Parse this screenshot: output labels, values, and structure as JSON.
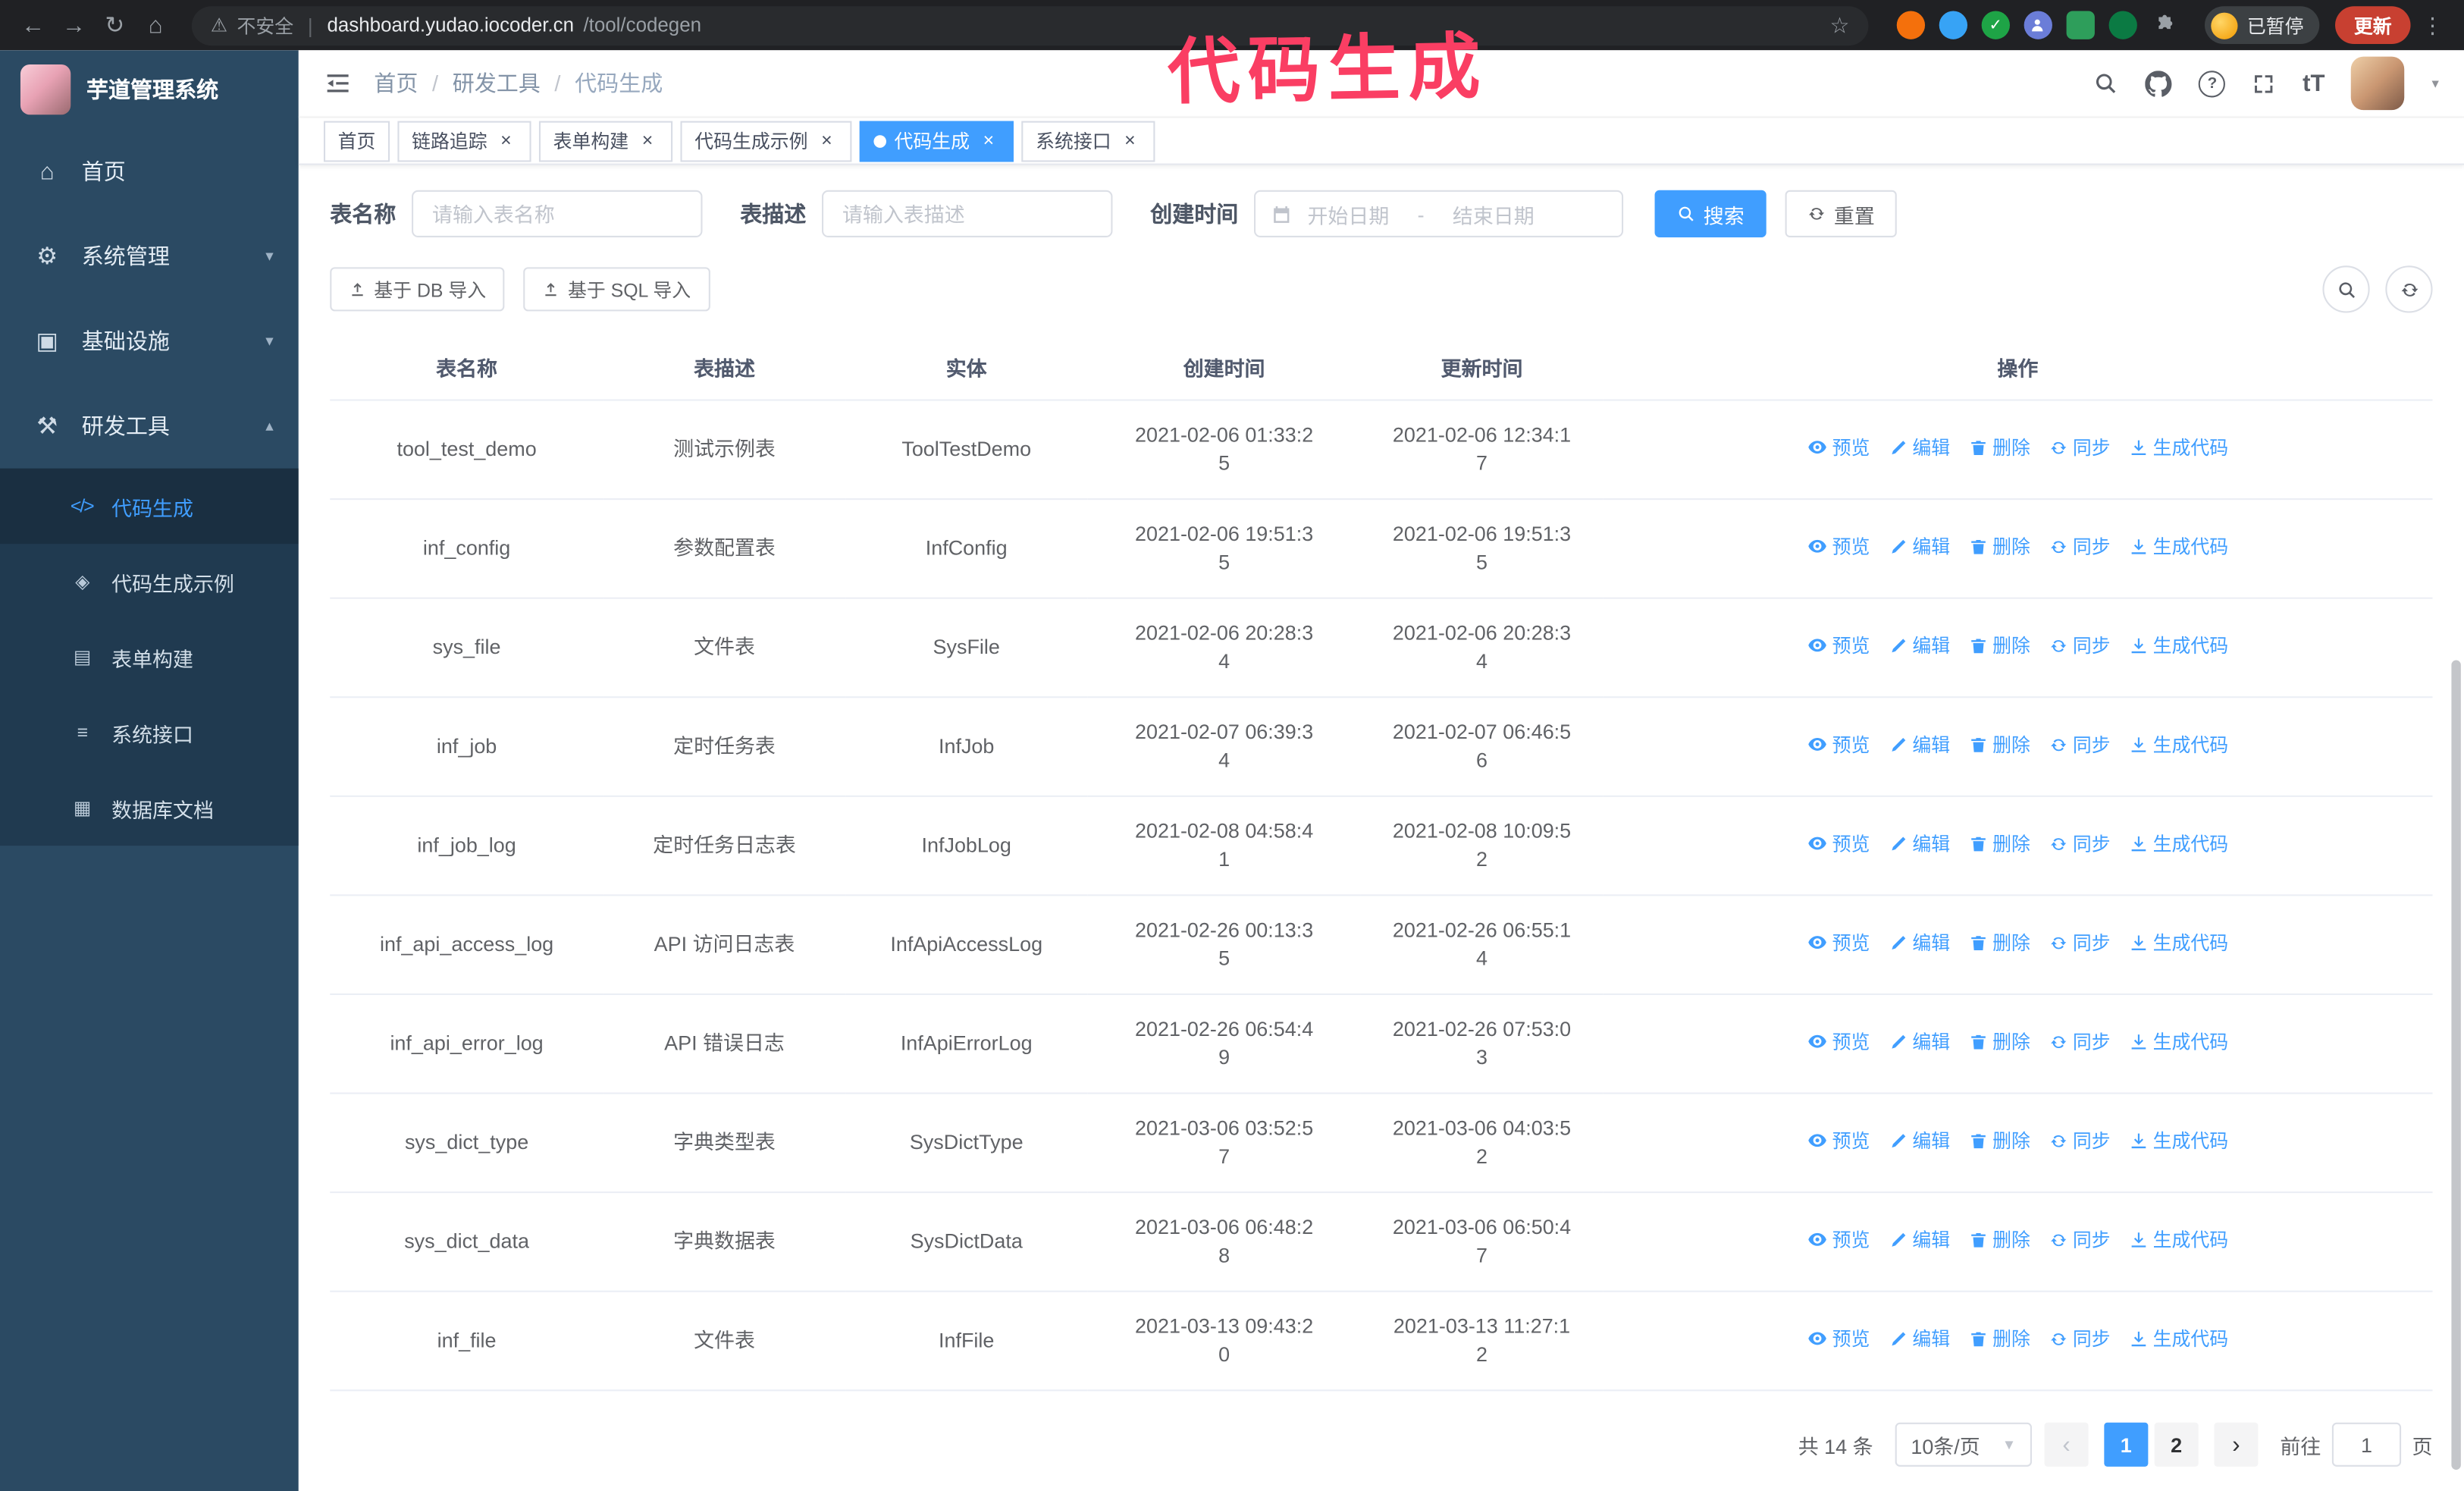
{
  "colors": {
    "accent": "#409eff",
    "annotation": "#fa3e63",
    "sidebar_bg": "#2b4a63",
    "chrome_bg": "#202124"
  },
  "annotation": {
    "text": "代码生成"
  },
  "browser": {
    "security_label": "不安全",
    "url_host": "dashboard.yudao.iocoder.cn",
    "url_path": "/tool/codegen",
    "paused_badge": "已暂停",
    "update_button": "更新"
  },
  "sidebar": {
    "logo_title": "芋道管理系统",
    "items": [
      {
        "key": "home",
        "label": "首页",
        "icon": "⌂",
        "icon_name": "home-icon"
      },
      {
        "key": "system-management",
        "label": "系统管理",
        "icon": "⚙",
        "icon_name": "gear-icon",
        "chevron": "down"
      },
      {
        "key": "infrastructure",
        "label": "基础设施",
        "icon": "▣",
        "icon_name": "monitor-icon",
        "chevron": "down"
      },
      {
        "key": "dev-tools",
        "label": "研发工具",
        "icon": "⚒",
        "icon_name": "tools-icon",
        "chevron": "up",
        "expanded": true
      }
    ],
    "subitems": [
      {
        "key": "codegen",
        "label": "代码生成",
        "icon": "</>",
        "icon_name": "code-icon",
        "active": true
      },
      {
        "key": "codegen-example",
        "label": "代码生成示例",
        "icon": "◈",
        "icon_name": "example-icon"
      },
      {
        "key": "form-builder",
        "label": "表单构建",
        "icon": "▤",
        "icon_name": "form-icon"
      },
      {
        "key": "system-api",
        "label": "系统接口",
        "icon": "≡",
        "icon_name": "api-icon"
      },
      {
        "key": "db-doc",
        "label": "数据库文档",
        "icon": "▦",
        "icon_name": "database-doc-icon"
      }
    ]
  },
  "header": {
    "breadcrumb": [
      "首页",
      "研发工具",
      "代码生成"
    ],
    "font_size_icon": "tT"
  },
  "tabs": [
    {
      "key": "home",
      "label": "首页",
      "closable": false
    },
    {
      "key": "tracer",
      "label": "链路追踪",
      "closable": true
    },
    {
      "key": "form-builder",
      "label": "表单构建",
      "closable": true
    },
    {
      "key": "codegen-example",
      "label": "代码生成示例",
      "closable": true
    },
    {
      "key": "codegen",
      "label": "代码生成",
      "closable": true,
      "active": true
    },
    {
      "key": "system-api",
      "label": "系统接口",
      "closable": true
    }
  ],
  "filters": {
    "table_name_label": "表名称",
    "table_name_placeholder": "请输入表名称",
    "table_desc_label": "表描述",
    "table_desc_placeholder": "请输入表描述",
    "create_time_label": "创建时间",
    "start_placeholder": "开始日期",
    "range_separator": "-",
    "end_placeholder": "结束日期",
    "search_button": "搜索",
    "reset_button": "重置"
  },
  "toolbar": {
    "import_db_button": "基于 DB 导入",
    "import_sql_button": "基于 SQL 导入"
  },
  "table": {
    "columns": [
      "表名称",
      "表描述",
      "实体",
      "创建时间",
      "更新时间",
      "操作"
    ],
    "ops": [
      {
        "key": "preview",
        "label": "预览",
        "icon_name": "eye-icon"
      },
      {
        "key": "edit",
        "label": "编辑",
        "icon_name": "edit-icon"
      },
      {
        "key": "delete",
        "label": "删除",
        "icon_name": "trash-icon"
      },
      {
        "key": "sync",
        "label": "同步",
        "icon_name": "sync-icon"
      },
      {
        "key": "generate",
        "label": "生成代码",
        "icon_name": "download-icon"
      }
    ],
    "rows": [
      {
        "name": "tool_test_demo",
        "desc": "测试示例表",
        "entity": "ToolTestDemo",
        "created": "2021-02-06 01:33:25",
        "updated": "2021-02-06 12:34:17"
      },
      {
        "name": "inf_config",
        "desc": "参数配置表",
        "entity": "InfConfig",
        "created": "2021-02-06 19:51:35",
        "updated": "2021-02-06 19:51:35"
      },
      {
        "name": "sys_file",
        "desc": "文件表",
        "entity": "SysFile",
        "created": "2021-02-06 20:28:34",
        "updated": "2021-02-06 20:28:34"
      },
      {
        "name": "inf_job",
        "desc": "定时任务表",
        "entity": "InfJob",
        "created": "2021-02-07 06:39:34",
        "updated": "2021-02-07 06:46:56"
      },
      {
        "name": "inf_job_log",
        "desc": "定时任务日志表",
        "entity": "InfJobLog",
        "created": "2021-02-08 04:58:41",
        "updated": "2021-02-08 10:09:52"
      },
      {
        "name": "inf_api_access_log",
        "desc": "API 访问日志表",
        "entity": "InfApiAccessLog",
        "created": "2021-02-26 00:13:35",
        "updated": "2021-02-26 06:55:14"
      },
      {
        "name": "inf_api_error_log",
        "desc": "API 错误日志",
        "entity": "InfApiErrorLog",
        "created": "2021-02-26 06:54:49",
        "updated": "2021-02-26 07:53:03"
      },
      {
        "name": "sys_dict_type",
        "desc": "字典类型表",
        "entity": "SysDictType",
        "created": "2021-03-06 03:52:57",
        "updated": "2021-03-06 04:03:52"
      },
      {
        "name": "sys_dict_data",
        "desc": "字典数据表",
        "entity": "SysDictData",
        "created": "2021-03-06 06:48:28",
        "updated": "2021-03-06 06:50:47"
      },
      {
        "name": "inf_file",
        "desc": "文件表",
        "entity": "InfFile",
        "created": "2021-03-13 09:43:20",
        "updated": "2021-03-13 11:27:12"
      }
    ]
  },
  "pagination": {
    "total": "共 14 条",
    "page_size": "10条/页",
    "pages": [
      "1",
      "2"
    ],
    "active_page": "1",
    "goto_label": "前往",
    "goto_value": "1",
    "goto_suffix": "页"
  }
}
